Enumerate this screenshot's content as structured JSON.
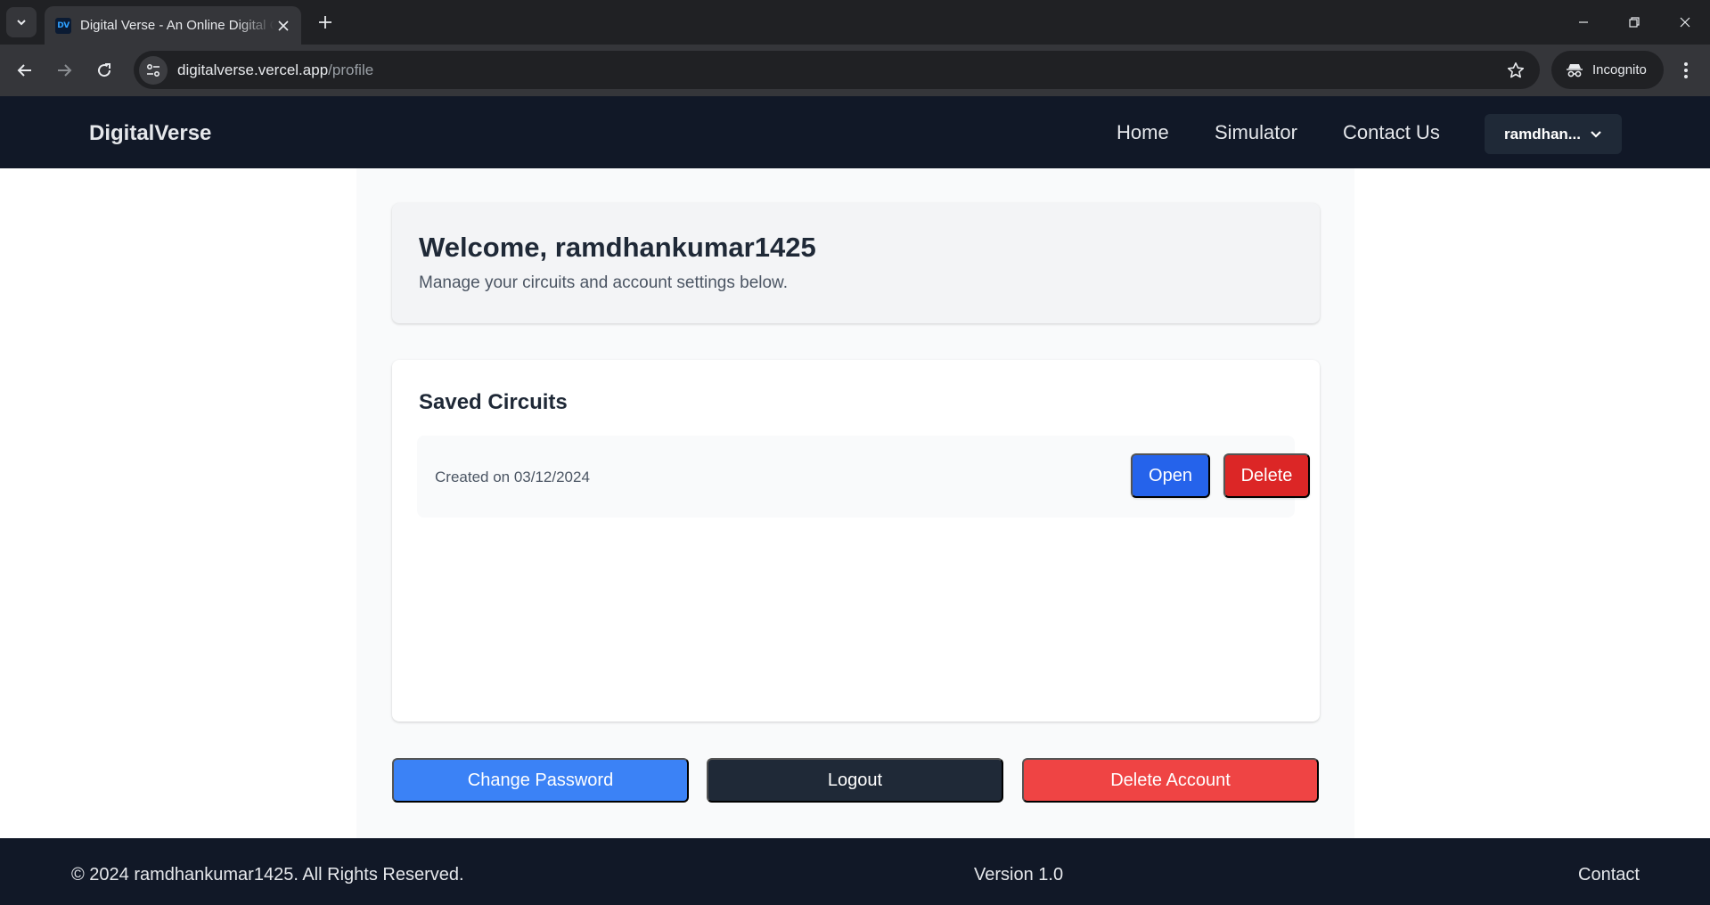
{
  "browser": {
    "tab_title": "Digital Verse - An Online Digital Circuit Simulator",
    "favicon_text": "DV",
    "url_host": "digitalverse.vercel.app",
    "url_path": "/profile",
    "incognito_label": "Incognito"
  },
  "navbar": {
    "brand": "DigitalVerse",
    "links": [
      "Home",
      "Simulator",
      "Contact Us"
    ],
    "user_label": "ramdhan..."
  },
  "welcome": {
    "title": "Welcome, ramdhankumar1425",
    "subtitle": "Manage your circuits and account settings below."
  },
  "circuits": {
    "title": "Saved Circuits",
    "items": [
      {
        "created": "Created on 03/12/2024",
        "open_label": "Open",
        "delete_label": "Delete"
      }
    ]
  },
  "actions": {
    "change_password": "Change Password",
    "logout": "Logout",
    "delete_account": "Delete Account"
  },
  "footer": {
    "copyright": "© 2024 ramdhankumar1425. All Rights Reserved.",
    "version": "Version 1.0",
    "contact": "Contact"
  },
  "colors": {
    "navbar_bg": "#111827",
    "primary_blue": "#2563eb",
    "change_password_blue": "#3b82f6",
    "danger_red": "#dc2626",
    "delete_account_red": "#ef4444",
    "logout_dark": "#1f2937"
  },
  "icons": [
    "tab-search-icon",
    "close-icon",
    "plus-icon",
    "minimize-icon",
    "restore-icon",
    "back-arrow-icon",
    "forward-arrow-icon",
    "reload-icon",
    "site-settings-icon",
    "star-icon",
    "incognito-icon",
    "more-vert-icon",
    "chevron-down-icon"
  ]
}
